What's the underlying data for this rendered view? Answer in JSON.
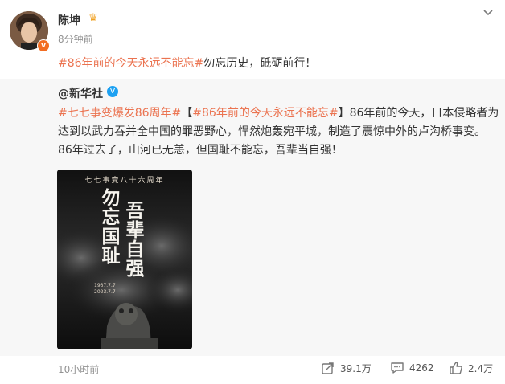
{
  "post": {
    "author": "陈坤",
    "crown_icon": "crown-icon",
    "verified_badge": "v",
    "time": "8分钟前",
    "topic": "#86年前的今天永远不能忘#",
    "text": "勿忘历史，砥砺前行！"
  },
  "repost": {
    "author": "@新华社",
    "verified_badge": "V",
    "topic1": "#七七事变爆发86周年#",
    "bracket_open": "【",
    "topic2": "#86年前的今天永远不能忘#",
    "bracket_close": "】",
    "line1_text": "86年前的今天，日本侵略者为",
    "line2": "达到以武力吞并全中国的罪恶野心，悍然炮轰宛平城，制造了震惊中外的卢沟桥事变。",
    "line3": "86年过去了，山河已无恙，但国耻不能忘，吾辈当自强！",
    "poster": {
      "heading": "七七事变八十六周年",
      "chars": [
        "勿",
        "忘",
        "国",
        "耻",
        "吾",
        "辈",
        "自",
        "强"
      ],
      "date1": "1937.7.7",
      "date2": "2023.7.7"
    }
  },
  "footer": {
    "time": "10小时前",
    "repost_count": "39.1万",
    "comment_count": "4262",
    "like_count": "2.4万"
  },
  "colors": {
    "topic": "#eb7350",
    "verified_orange": "#f26d22",
    "verified_blue": "#1da1f2",
    "repost_bg": "#f7f7f7"
  }
}
